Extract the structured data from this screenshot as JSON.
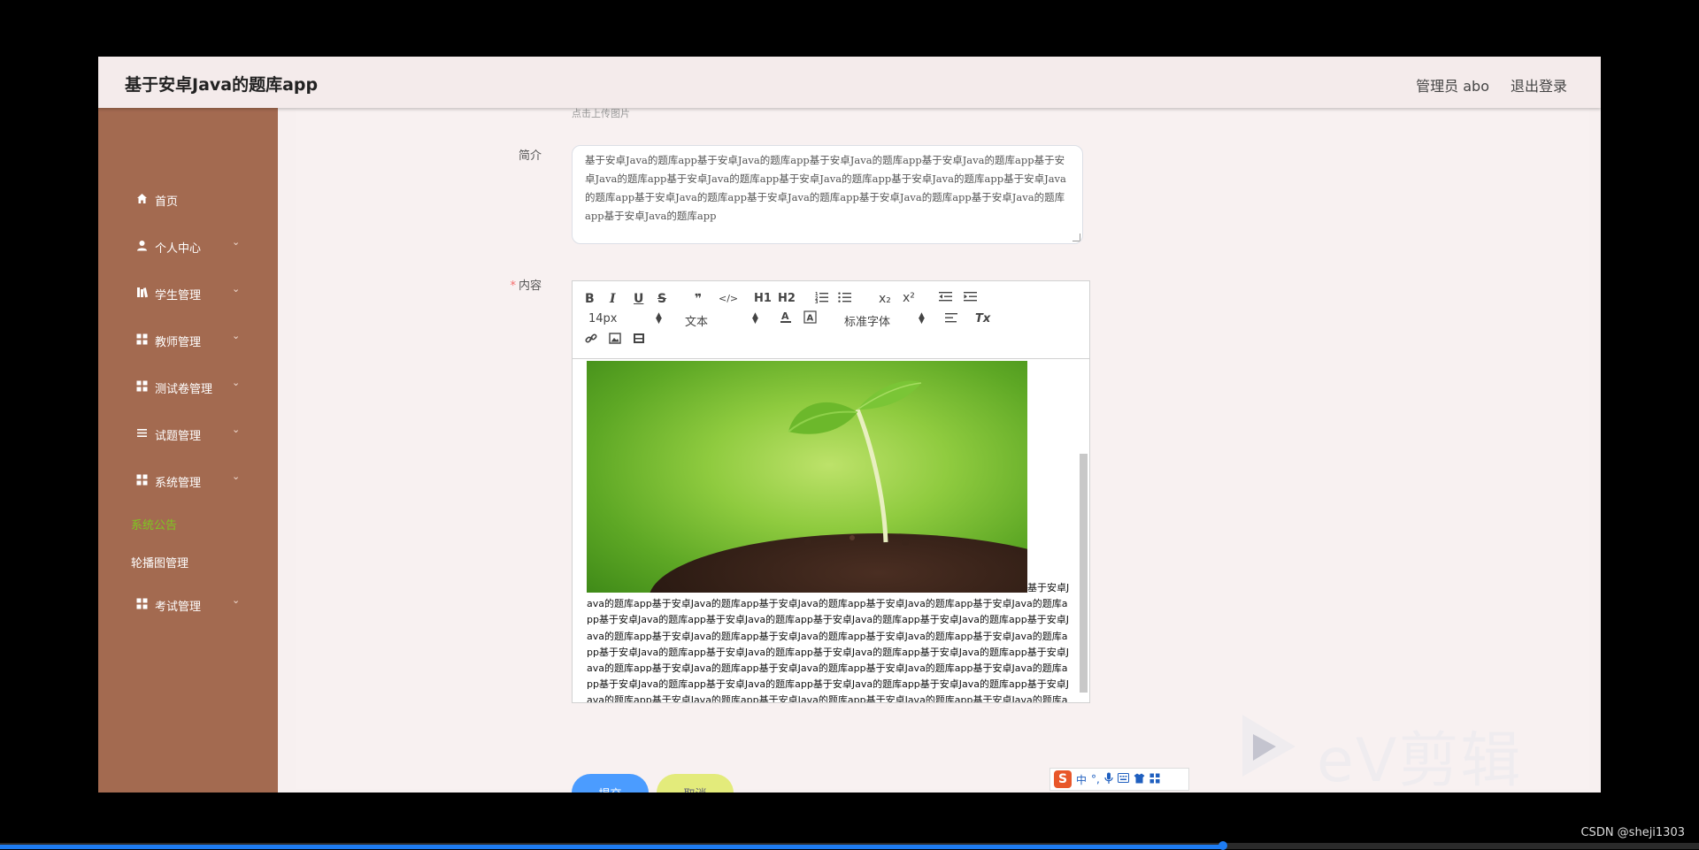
{
  "app": {
    "title": "基于安卓Java的题库app",
    "user_label": "管理员 abo",
    "logout_label": "退出登录"
  },
  "sidebar": {
    "items": [
      {
        "label": "首页",
        "icon": "home-icon",
        "has_children": false
      },
      {
        "label": "个人中心",
        "icon": "user-icon",
        "has_children": true
      },
      {
        "label": "学生管理",
        "icon": "book-icon",
        "has_children": true
      },
      {
        "label": "教师管理",
        "icon": "grid-icon",
        "has_children": true
      },
      {
        "label": "测试卷管理",
        "icon": "grid-icon",
        "has_children": true
      },
      {
        "label": "试题管理",
        "icon": "list-icon",
        "has_children": true
      },
      {
        "label": "系统管理",
        "icon": "grid-icon",
        "has_children": true
      }
    ],
    "sub_items": [
      {
        "label": "系统公告",
        "active": true,
        "color": "#7ec820"
      },
      {
        "label": "轮播图管理",
        "active": false,
        "color": "#ffffff"
      }
    ],
    "last_item": {
      "label": "考试管理",
      "icon": "grid-icon",
      "has_children": true
    }
  },
  "form": {
    "hint_cut": "点击上传图片",
    "intro_label": "简介",
    "intro_text": "基于安卓Java的题库app基于安卓Java的题库app基于安卓Java的题库app基于安卓Java的题库app基于安卓Java的题库app基于安卓Java的题库app基于安卓Java的题库app基于安卓Java的题库app基于安卓Java的题库app基于安卓Java的题库app基于安卓Java的题库app基于安卓Java的题库app基于安卓Java的题库app基于安卓Java的题库app",
    "content_label": "内容",
    "content_required": "*",
    "toolbar": {
      "bold": "B",
      "italic": "I",
      "underline": "U",
      "strike": "S",
      "quote": "❞",
      "code": "</>",
      "h1": "H1",
      "h2": "H2",
      "sub": "x₂",
      "sup": "x²",
      "font_size": "14px",
      "text_type": "文本",
      "font_family": "标准字体",
      "clear_format": "Tx"
    },
    "content_text": "基于安卓Java的题库app基于安卓Java的题库app基于安卓Java的题库app基于安卓Java的题库app基于安卓Java的题库app基于安卓Java的题库app基于安卓Java的题库app基于安卓Java的题库app基于安卓Java的题库app基于安卓Java的题库app基于安卓Java的题库app基于安卓Java的题库app基于安卓Java的题库app基于安卓Java的题库app基于安卓Java的题库app基于安卓Java的题库app基于安卓Java的题库app基于安卓Java的题库app基于安卓Java的题库app基于安卓Java的题库app基于安卓Java的题库app基于安卓Java的题库app基于安卓Java的题库app基于安卓Java的题库app基于安卓Java的题库app基于安卓Java的题库app基于安卓Java的题库app基于安卓Java的题库app基于安卓Java的题库app基于安卓Java的题库app基于安卓Java的题库app基于安卓Java的题库app基于安卓Java的题库app基于安卓Java的题库app基于安卓Java的题库app基于安卓Java的题库app基于安卓Java的题库app",
    "submit_label": "提交",
    "cancel_label": "取消"
  },
  "overlay": {
    "ime_label": "中",
    "watermark": "eV剪辑",
    "credit": "CSDN @sheji1303",
    "progress": 0.72
  },
  "colors": {
    "sidebar": "#a36a50",
    "submit": "#4b9cff",
    "cancel": "#e3eb7b",
    "active_sub": "#7ec820"
  }
}
